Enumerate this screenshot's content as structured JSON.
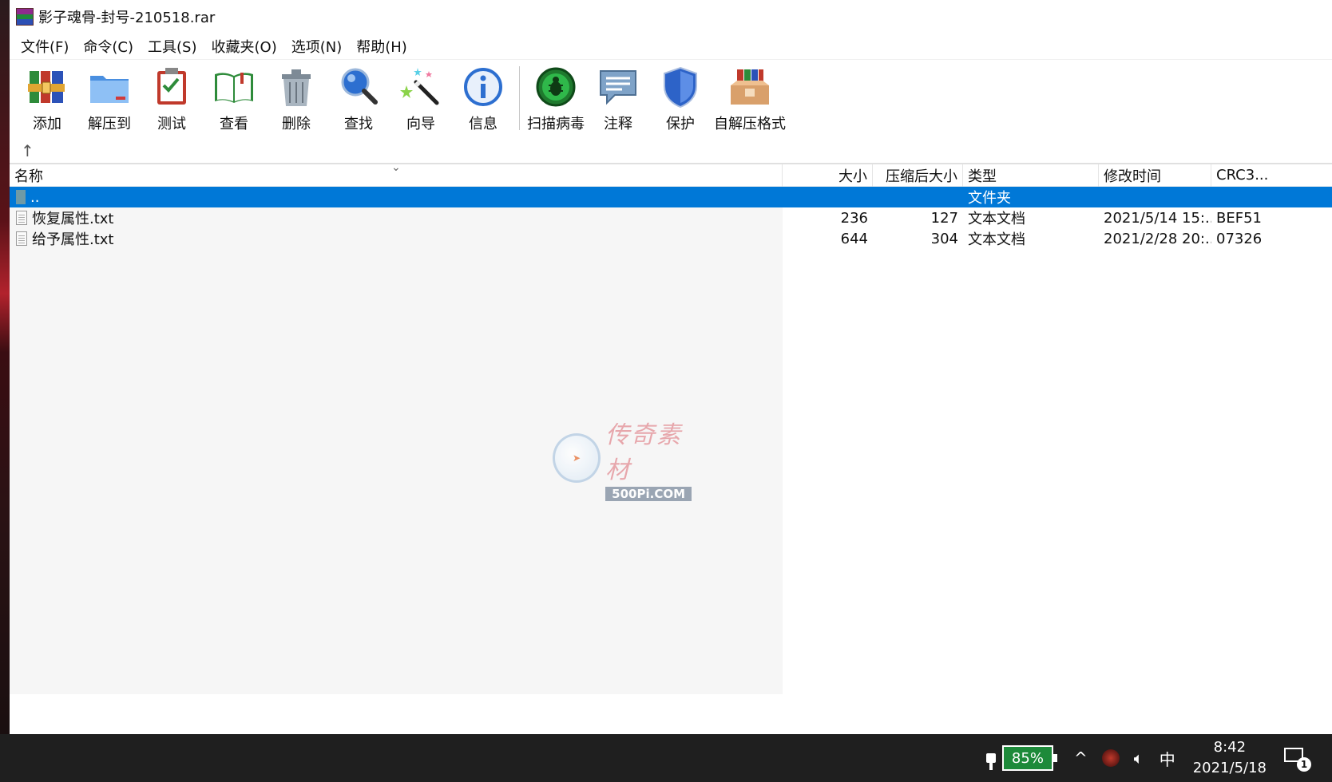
{
  "window": {
    "title": "影子魂骨-封号-210518.rar"
  },
  "menu": [
    {
      "label": "文件(F)"
    },
    {
      "label": "命令(C)"
    },
    {
      "label": "工具(S)"
    },
    {
      "label": "收藏夹(O)"
    },
    {
      "label": "选项(N)"
    },
    {
      "label": "帮助(H)"
    }
  ],
  "toolbar": {
    "add": "添加",
    "extract": "解压到",
    "test": "测试",
    "view": "查看",
    "delete": "删除",
    "find": "查找",
    "wizard": "向导",
    "info": "信息",
    "scan": "扫描病毒",
    "comment": "注释",
    "protect": "保护",
    "sfx": "自解压格式"
  },
  "columns": {
    "name": "名称",
    "size": "大小",
    "packed": "压缩后大小",
    "type": "类型",
    "modified": "修改时间",
    "crc": "CRC3..."
  },
  "rows": [
    {
      "name": "..",
      "size": "",
      "packed": "",
      "type": "文件夹",
      "modified": "",
      "crc": ""
    },
    {
      "name": "恢复属性.txt",
      "size": "236",
      "packed": "127",
      "type": "文本文档",
      "modified": "2021/5/14 15:...",
      "crc": "BEF51"
    },
    {
      "name": "给予属性.txt",
      "size": "644",
      "packed": "304",
      "type": "文本文档",
      "modified": "2021/2/28 20:...",
      "crc": "07326"
    }
  ],
  "watermark": {
    "cn": "传奇素材",
    "en": "500Pi.COM"
  },
  "taskbar": {
    "battery": "85%",
    "ime": "中",
    "time": "8:42",
    "date": "2021/5/18",
    "notifications": "1",
    "chevron": "^"
  },
  "colors": {
    "selection": "#0078d7",
    "battery_fill": "#1d8a3a",
    "taskbar": "#1f1f1f"
  },
  "icons": {
    "navigate_up": "up-arrow-icon",
    "tray_volume": "speaker-icon"
  }
}
